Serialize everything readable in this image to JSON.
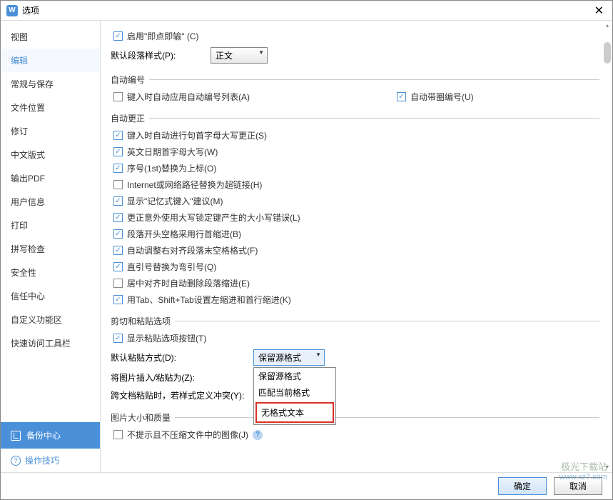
{
  "titlebar": {
    "title": "选项"
  },
  "sidebar": {
    "items": [
      {
        "label": "视图"
      },
      {
        "label": "编辑"
      },
      {
        "label": "常规与保存"
      },
      {
        "label": "文件位置"
      },
      {
        "label": "修订"
      },
      {
        "label": "中文版式"
      },
      {
        "label": "输出PDF"
      },
      {
        "label": "用户信息"
      },
      {
        "label": "打印"
      },
      {
        "label": "拼写检查"
      },
      {
        "label": "安全性"
      },
      {
        "label": "信任中心"
      },
      {
        "label": "自定义功能区"
      },
      {
        "label": "快速访问工具栏"
      }
    ],
    "backup": "备份中心",
    "tips": "操作技巧"
  },
  "content": {
    "click_type": {
      "label": "启用\"即点即输\" (C)",
      "checked": true
    },
    "default_para_style": {
      "label": "默认段落样式(P):",
      "value": "正文"
    },
    "auto_number": {
      "header": "自动编号",
      "apply_list": {
        "label": "键入时自动应用自动编号列表(A)",
        "checked": false
      },
      "ring_number": {
        "label": "自动带圈编号(U)",
        "checked": true
      }
    },
    "auto_correct": {
      "header": "自动更正",
      "items": [
        {
          "label": "键入时自动进行句首字母大写更正(S)",
          "checked": true
        },
        {
          "label": "英文日期首字母大写(W)",
          "checked": true
        },
        {
          "label": "序号(1st)替换为上标(O)",
          "checked": true
        },
        {
          "label": "Internet或网络路径替换为超链接(H)",
          "checked": false
        },
        {
          "label": "显示\"记忆式键入\"建议(M)",
          "checked": true
        },
        {
          "label": "更正意外使用大写锁定键产生的大小写错误(L)",
          "checked": true
        },
        {
          "label": "段落开头空格采用行首缩进(B)",
          "checked": true
        },
        {
          "label": "自动调整右对齐段落末空格格式(F)",
          "checked": true
        },
        {
          "label": "直引号替换为弯引号(Q)",
          "checked": true
        },
        {
          "label": "居中对齐时自动删除段落缩进(E)",
          "checked": false
        },
        {
          "label": "用Tab、Shift+Tab设置左缩进和首行缩进(K)",
          "checked": true
        }
      ]
    },
    "cut_paste": {
      "header": "剪切和粘贴选项",
      "show_paste_btn": {
        "label": "显示粘贴选项按钮(T)",
        "checked": true
      },
      "default_paste": {
        "label": "默认粘贴方式(D):",
        "value": "保留源格式"
      },
      "insert_image": {
        "label": "将图片插入/粘贴为(Z):",
        "value": ""
      },
      "cross_doc": {
        "label": "跨文档粘贴时，若样式定义冲突(Y):"
      },
      "dropdown": {
        "opt1": "保留源格式",
        "opt2": "匹配当前格式",
        "opt3": "无格式文本"
      }
    },
    "image_quality": {
      "header": "图片大小和质量",
      "no_compress": {
        "label": "不提示且不压缩文件中的图像(J)",
        "checked": false
      }
    }
  },
  "footer": {
    "ok": "确定",
    "cancel": "取消"
  },
  "watermark": {
    "line1": "极光下载站",
    "line2": "www.xz7.com"
  }
}
